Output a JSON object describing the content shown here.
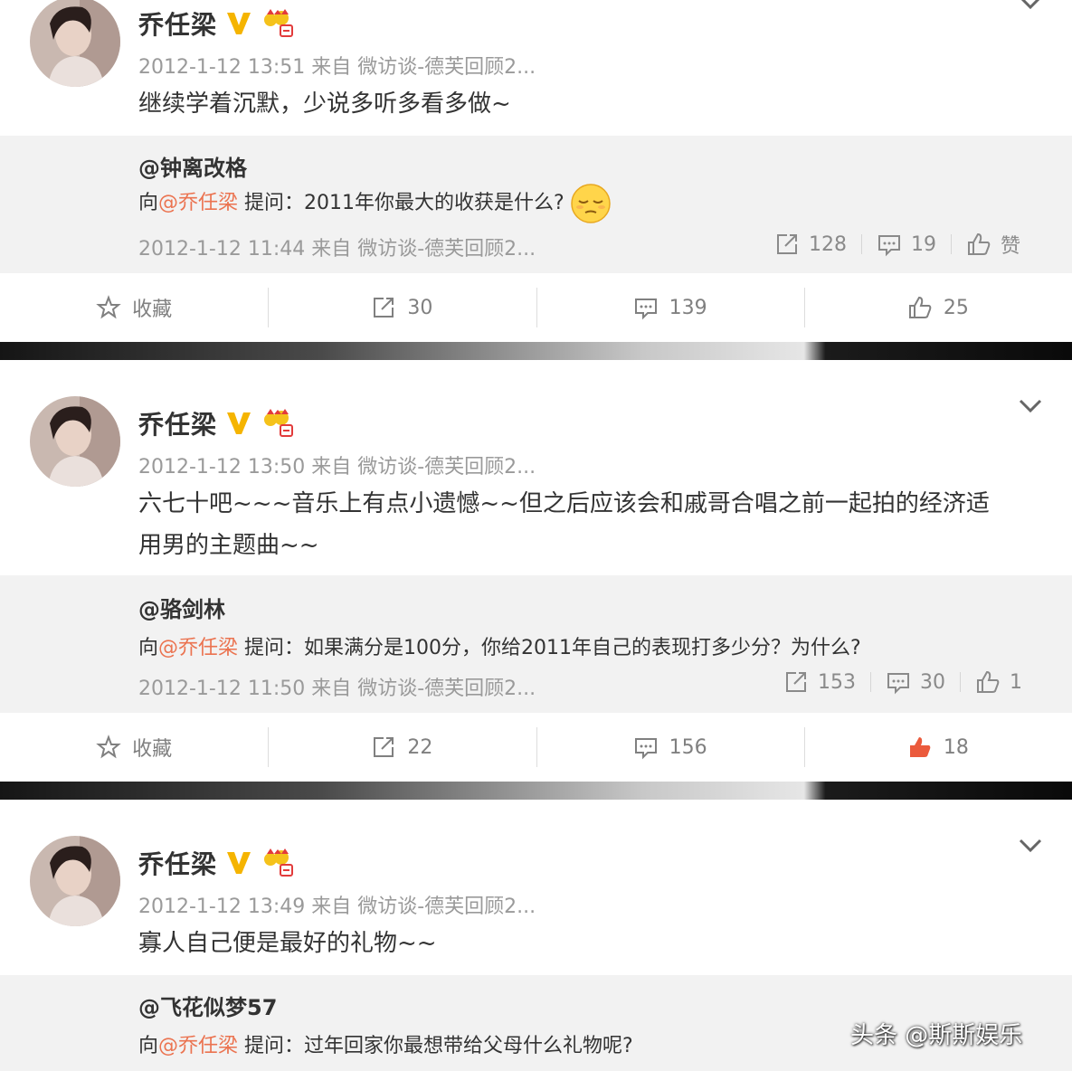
{
  "posts": [
    {
      "author": "乔任梁",
      "meta": "2012-1-12 13:51 来自 微访谈-德芙回顾2...",
      "content": "继续学着沉默，少说多听多看多做~",
      "quote": {
        "user": "@钟离改格",
        "prefix": "向",
        "mention": "@乔任梁",
        "text": " 提问：2011年你最大的收获是什么?",
        "meta": "2012-1-12 11:44 来自 微访谈-德芙回顾2...",
        "repost": "128",
        "comment": "19",
        "like": "赞"
      },
      "actions": {
        "fav": "收藏",
        "repost": "30",
        "comment": "139",
        "like": "25"
      }
    },
    {
      "author": "乔任梁",
      "meta": "2012-1-12 13:50 来自 微访谈-德芙回顾2...",
      "content_line1": "六七十吧~~~音乐上有点小遗憾~~但之后应该会和戚哥合唱之前一起拍的经济适",
      "content_line2": "用男的主题曲~~",
      "quote": {
        "user": "@骆剑林",
        "prefix": "向",
        "mention": "@乔任梁",
        "text": " 提问：如果满分是100分，你给2011年自己的表现打多少分？为什么?",
        "meta": "2012-1-12 11:50 来自 微访谈-德芙回顾2...",
        "repost": "153",
        "comment": "30",
        "like": "1"
      },
      "actions": {
        "fav": "收藏",
        "repost": "22",
        "comment": "156",
        "like": "18"
      }
    },
    {
      "author": "乔任梁",
      "meta": "2012-1-12 13:49 来自 微访谈-德芙回顾2...",
      "content": "寡人自己便是最好的礼物~~",
      "quote": {
        "user": "@飞花似梦57",
        "prefix": "向",
        "mention": "@乔任梁",
        "text": " 提问：过年回家你最想带给父母什么礼物呢?"
      }
    }
  ],
  "watermark": "头条 @斯斯娱乐",
  "colors": {
    "mention": "#eb7350",
    "like_active": "#eb5a3c",
    "vip_badge": "#f5b400",
    "quote_bg": "#f2f2f2"
  },
  "icons": [
    "chevron-down-icon",
    "verified-v-icon",
    "vip-crown-icon",
    "repost-icon",
    "comment-icon",
    "like-icon",
    "star-icon",
    "pensive-emoji-icon"
  ]
}
